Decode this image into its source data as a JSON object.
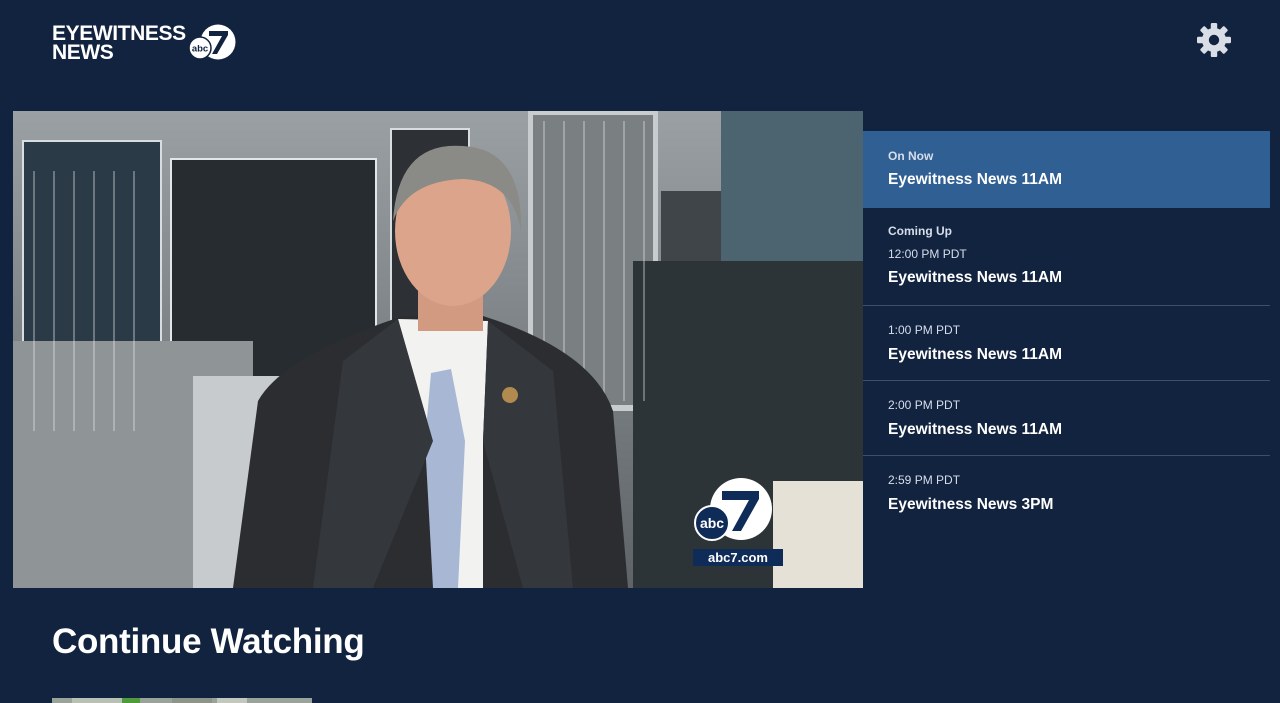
{
  "header": {
    "logo_line1": "EYEWITNESS",
    "logo_line2": "NEWS",
    "logo_badge_small": "abc",
    "logo_badge_number": "7",
    "settings_icon": "gear-icon"
  },
  "player": {
    "bug_small": "abc",
    "bug_number": "7",
    "bug_site": "abc7.com"
  },
  "schedule": [
    {
      "kicker": "On Now",
      "time": "",
      "title": "Eyewitness News 11AM",
      "active": true
    },
    {
      "kicker": "Coming Up",
      "time": "12:00 PM PDT",
      "title": "Eyewitness News 11AM",
      "active": false
    },
    {
      "kicker": "",
      "time": "1:00 PM PDT",
      "title": "Eyewitness News 11AM",
      "active": false
    },
    {
      "kicker": "",
      "time": "2:00 PM PDT",
      "title": "Eyewitness News 11AM",
      "active": false
    },
    {
      "kicker": "",
      "time": "2:59 PM PDT",
      "title": "Eyewitness News 3PM",
      "active": false
    }
  ],
  "continue_watching": {
    "title": "Continue Watching"
  },
  "colors": {
    "background": "#12233f",
    "active_row": "#2f5f93",
    "divider": "#3b4f6e"
  }
}
